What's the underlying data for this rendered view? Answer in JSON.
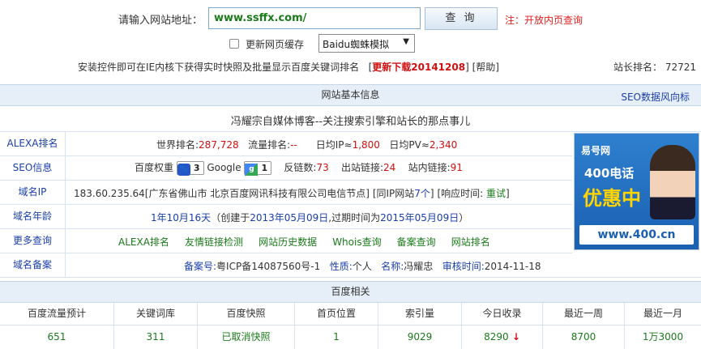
{
  "search": {
    "label": "请输入网站地址：",
    "url_value": "www.ssffx.com/",
    "query_button": "查 询",
    "note": "注：开放内页查询"
  },
  "options": {
    "refresh_cache_label": "更新网页缓存",
    "refresh_cache_checked": false,
    "spider_select": "Baidu蜘蛛模拟"
  },
  "info_bar": {
    "text": "安装控件即可在IE内核下获得实时快照及批量显示百度关键词排名",
    "download": "更新下载20141208",
    "help": "帮助",
    "rank_label": "站长排名：",
    "rank_value": "72721"
  },
  "basic": {
    "header": "网站基本信息",
    "seo_trend_link": "SEO数据风向标",
    "site_title": "冯耀宗自媒体博客--关注搜索引擎和站长的那点事儿",
    "rows": {
      "alexa": {
        "label": "ALEXA排名",
        "world_label": "世界排名:",
        "world_value": "287,728",
        "traffic_label": "流量排名:",
        "traffic_value": "--",
        "ip_label": "日均IP≈",
        "ip_value": "1,800",
        "pv_label": "日均PV≈",
        "pv_value": "2,340"
      },
      "seo": {
        "label": "SEO信息",
        "baidu_weight_label": "百度权重",
        "baidu_weight_value": "3",
        "google_label": "Google",
        "google_value": "1",
        "backlinks_label": "反链数:",
        "backlinks_value": "73",
        "outlinks_label": "出站链接:",
        "outlinks_value": "24",
        "inlinks_label": "站内链接:",
        "inlinks_value": "91"
      },
      "ip": {
        "label": "域名IP",
        "value": "183.60.235.64[广东省佛山市 北京百度网讯科技有限公司电信节点]",
        "same_ip_prefix": "[同IP网站",
        "same_ip_count": "7个",
        "same_ip_suffix": "]",
        "response_prefix": "[响应时间:",
        "retest": "重试",
        "response_suffix": "]"
      },
      "age": {
        "label": "域名年龄",
        "age_value": "1年10月16天",
        "created_prefix": "（创建于",
        "created_date": "2013年05月09日",
        "expire_prefix": ",过期时间为",
        "expire_date": "2015年05月09日",
        "suffix": "）"
      },
      "more": {
        "label": "更多查询",
        "links": [
          "ALEXA排名",
          "友情链接检测",
          "网站历史数据",
          "Whois查询",
          "备案查询",
          "网站排名"
        ]
      },
      "icp": {
        "label": "域名备案",
        "icp_label": "备案号:",
        "icp_value": "粤ICP备14087560号-1",
        "nature_label": "性质:",
        "nature_value": "个人",
        "name_label": "名称:",
        "name_value": "冯耀忠",
        "audit_label": "审核时间:",
        "audit_value": "2014-11-18"
      }
    },
    "ad": {
      "logo": "易号网",
      "phone": "400电话",
      "slogan": "优惠中",
      "site": "www.400.cn"
    }
  },
  "baidu": {
    "header": "百度相关",
    "columns": [
      "百度流量预计",
      "关键词库",
      "百度快照",
      "首页位置",
      "索引量",
      "今日收录",
      "最近一周",
      "最近一月"
    ],
    "values": [
      "651",
      "311",
      "已取消快照",
      "1",
      "9029",
      "8290",
      "8700",
      "1万3000"
    ],
    "today_trend": "down",
    "colors": {
      "green": "#1a7a1a",
      "red": "#d01010",
      "blue": "#1a3fa8"
    }
  }
}
